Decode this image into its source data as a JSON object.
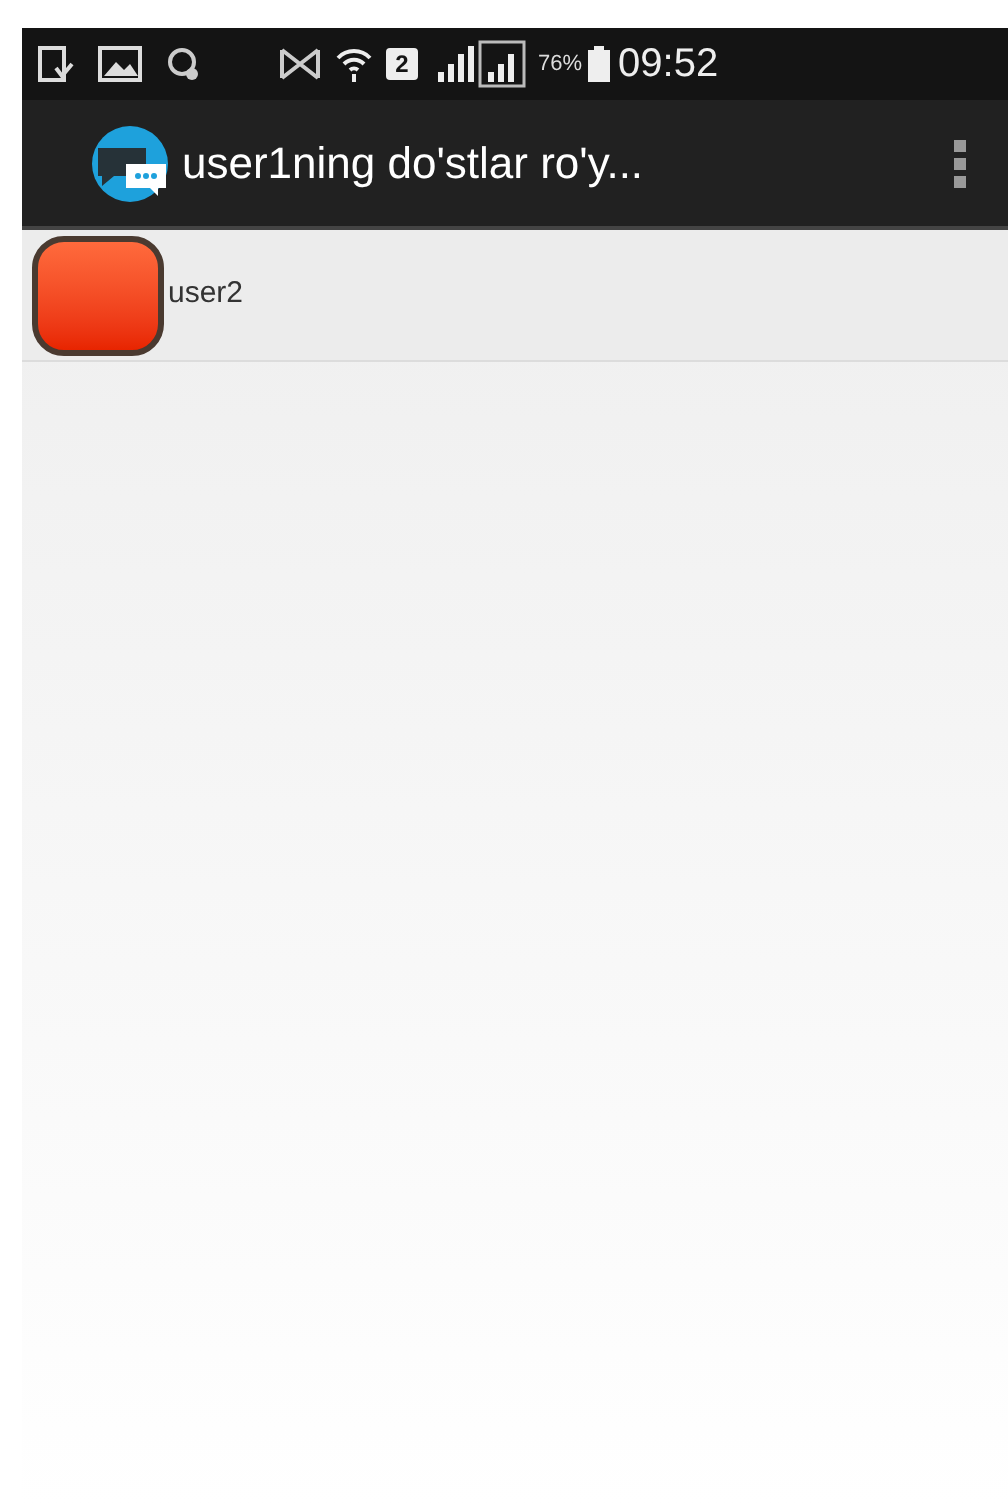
{
  "status_bar": {
    "battery_text": "76%",
    "time": "09:52",
    "sim_slot": "2"
  },
  "action_bar": {
    "title": "user1ning do'stlar ro'y..."
  },
  "contacts": [
    {
      "name": "user2"
    }
  ]
}
